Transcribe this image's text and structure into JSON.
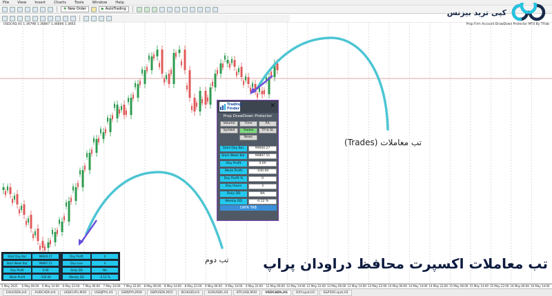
{
  "menu": [
    "File",
    "View",
    "Insert",
    "Charts",
    "Tools",
    "Window",
    "Help"
  ],
  "toolbar": {
    "new_order": "New Order",
    "auto_trading": "AutoTrading"
  },
  "chart": {
    "symbol_info": "USDCAD,H1  1.3679B 1.36807 1.36806 1.3663",
    "ea_title": "Prop Firm Account DrawDown Protector MT4 By TFlab"
  },
  "logo": {
    "text": "کپی ترید بیزنس"
  },
  "panel": {
    "brand_line1": "Trading",
    "brand_line2": "Finder",
    "close": "✕",
    "title": "Prop DrawDown Protector",
    "buttons": [
      "Volume",
      "Time",
      "P/L",
      "Symbol",
      "Trades",
      "TP & SL",
      "News"
    ],
    "active_button": "Trades",
    "rows": [
      {
        "label": "Start Day Bal.",
        "value": "99600.27"
      },
      {
        "label": "Start Week Bal.",
        "value": "99897.51"
      },
      {
        "label": "Day Profit",
        "value": "0.00"
      },
      {
        "label": "Week Profit",
        "value": "-100.00"
      },
      {
        "label": "Day Profit %",
        "value": "0"
      },
      {
        "label": "Day Hours",
        "value": "3"
      },
      {
        "label": "Daily DD",
        "value": "NA"
      },
      {
        "label": "Weekly DD",
        "value": "-0.12 %"
      }
    ],
    "data_tab": "DATA TAB"
  },
  "dashboard": {
    "left": [
      {
        "label": "Start Day Bal.",
        "value": "99600.27"
      },
      {
        "label": "Start Week Bal.",
        "value": "99897.51"
      },
      {
        "label": "Day Profit",
        "value": "0.00"
      },
      {
        "label": "Week Profit",
        "value": "-100.00"
      }
    ],
    "right": [
      {
        "label": "Day Profit",
        "value": "0"
      },
      {
        "label": "Day Loss",
        "value": "0"
      },
      {
        "label": "Daily DD",
        "value": "NA"
      },
      {
        "label": "Weekly DD",
        "value": "-0.12 %"
      }
    ]
  },
  "annotations": {
    "trades_tab": "تب معاملات (Trades)",
    "second_tab": "تب دوم",
    "headline": "تب معاملات اکسپرت محافظ دراودان پراپ"
  },
  "time_axis": [
    "5 May 2025",
    "6 May 06:00",
    "6 May 14:00",
    "6 May 22:00",
    "7 May 06:00",
    "7 May 14:00",
    "7 May 22:00",
    "8 May 06:00",
    "8 May 14:00",
    "8 May 22:00",
    "9 May 06:00",
    "9 May 14:00",
    "9 May 22:00",
    "12 May 06:00",
    "12 May 14:00",
    "12 May 22:00",
    "13 May 06:00",
    "13 May 14:00",
    "13 May 22:00",
    "14 May 06:00",
    "14 May 14:00",
    "14 May 22:00",
    "15 May 06:00",
    "15 May 14:00",
    "15 May 22:00",
    "16 May 06:00",
    "16 May 14:00"
  ],
  "symbol_tabs": [
    "EAUUSDh,H4",
    "AUDCADh,H4",
    "USDCHFh,M30",
    "USDJPYh,H1",
    "GBPJPYh,M30",
    "GBPUSDh,M15",
    "BCHUSD,H1",
    "EURUSDh,H1",
    "BTCUSD,M30",
    "USDCADh,H1",
    "DXY.spot,H1",
    "S&P500.spot,H1"
  ],
  "active_symbol_tab": "USDCADh,H1",
  "colors": {
    "accent_cyan": "#23c8ee",
    "arrow_purple": "#6a4fd8",
    "curve_teal": "#4cc5d3",
    "panel_border": "#7a3fb0",
    "candle_red": "#e05a5a",
    "candle_green": "#2d9b4f"
  }
}
